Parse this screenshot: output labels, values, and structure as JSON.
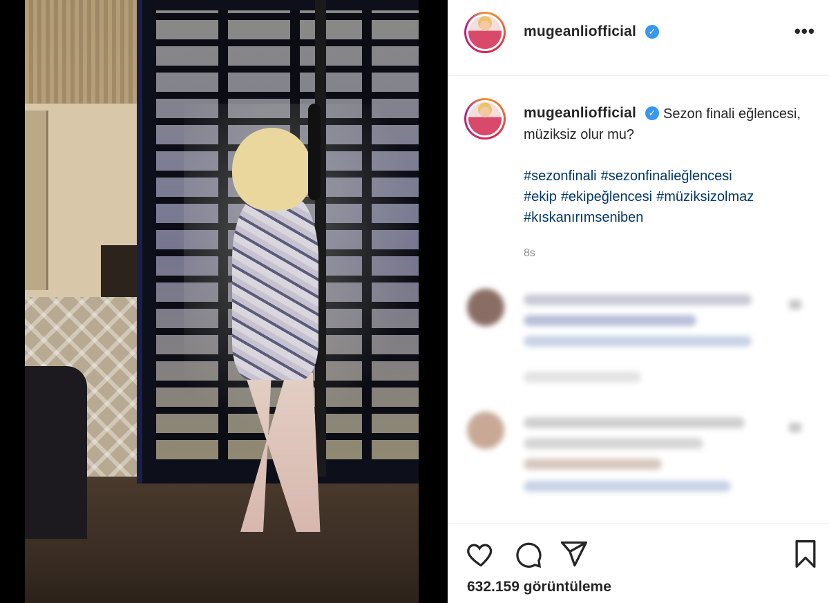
{
  "post": {
    "username": "mugeanliofficial",
    "verified": true,
    "more_label": "•••",
    "caption": "Sezon finali eğlencesi, müziksiz olur mu?",
    "hashtags": [
      "#sezonfinali",
      "#sezonfinalieğlencesi",
      "#ekip",
      "#ekipeğlencesi",
      "#müziksizolmaz",
      "#kıskanırımseniben"
    ],
    "time": "8s",
    "views": "632.159 görüntüleme"
  },
  "icons": {
    "like": "heart-icon",
    "comment": "comment-bubble-icon",
    "share": "paper-plane-icon",
    "save": "bookmark-icon",
    "verified": "verified-badge-icon",
    "more": "more-options-icon"
  },
  "colors": {
    "link": "#00376b",
    "verified": "#3897f0",
    "text": "#262626",
    "muted": "#8e8e8e"
  }
}
